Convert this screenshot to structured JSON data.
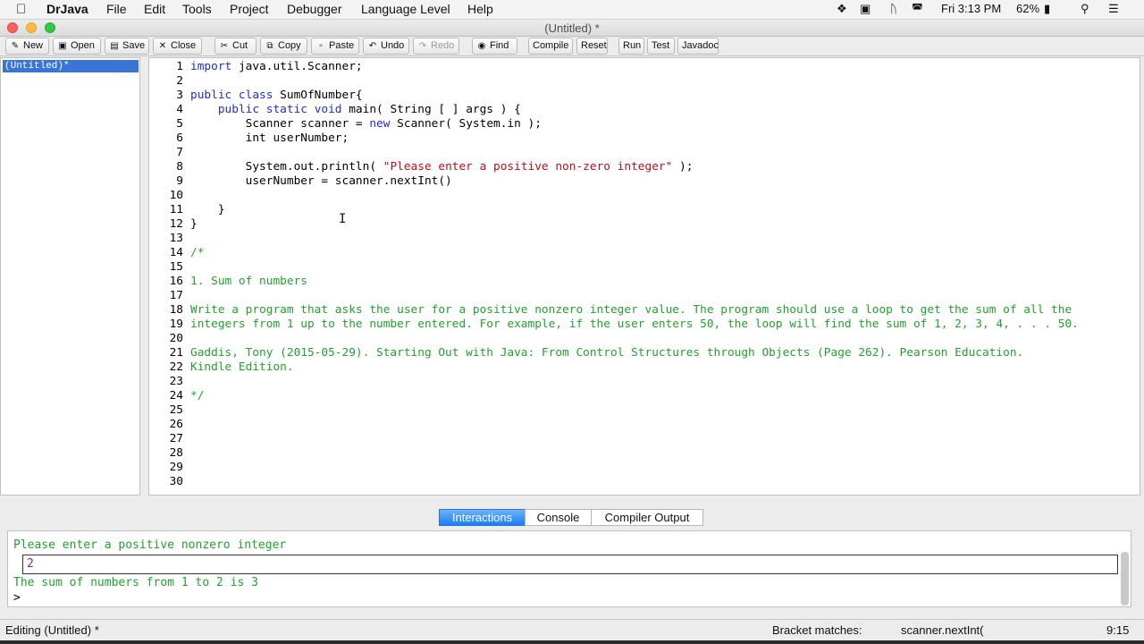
{
  "menubar": {
    "app_name": "DrJava",
    "menus": [
      "File",
      "Edit",
      "Tools",
      "Project",
      "Debugger",
      "Language Level",
      "Help"
    ],
    "clock": "Fri 3:13 PM",
    "battery": "62%"
  },
  "window": {
    "title": "(Untitled) *"
  },
  "toolbar": {
    "new": "New",
    "open": "Open",
    "save": "Save",
    "close": "Close",
    "cut": "Cut",
    "copy": "Copy",
    "paste": "Paste",
    "undo": "Undo",
    "redo": "Redo",
    "find": "Find",
    "compile": "Compile",
    "reset": "Reset",
    "run": "Run",
    "test": "Test",
    "javadoc": "Javadoc"
  },
  "files": {
    "selected": "(Untitled)*"
  },
  "editor": {
    "line_numbers": [
      "1",
      "2",
      "3",
      "4",
      "5",
      "6",
      "7",
      "8",
      "9",
      "10",
      "11",
      "12",
      "13",
      "14",
      "15",
      "16",
      "17",
      "18",
      "19",
      "20",
      "21",
      "22",
      "23",
      "24",
      "25",
      "26",
      "27",
      "28",
      "29",
      "30"
    ],
    "l1_kw": "import",
    "l1_rest": " java.util.Scanner;",
    "l3_kw": "public class",
    "l3_rest": " SumOfNumber{",
    "l4_indent": "    ",
    "l4_kw": "public static void",
    "l4_rest": " main( String [ ] args ) {",
    "l5_a": "        Scanner scanner = ",
    "l5_kw": "new",
    "l5_b": " Scanner( System.in );",
    "l6": "        int userNumber;",
    "l8_a": "        System.out.println( ",
    "l8_str": "\"Please enter a positive non-zero integer\"",
    "l8_b": " );",
    "l9": "        userNumber = scanner.nextInt()",
    "l11": "    }",
    "l12": "}",
    "l14": "/*",
    "l16": "1. Sum of numbers",
    "l18": "Write a program that asks the user for a positive nonzero integer value. The program should use a loop to get the sum of all the",
    "l19": "integers from 1 up to the number entered. For example, if the user enters 50, the loop will find the sum of 1, 2, 3, 4, . . . 50.",
    "l21": "Gaddis, Tony (2015-05-29). Starting Out with Java: From Control Structures through Objects (Page 262). Pearson Education.",
    "l22": "Kindle Edition.",
    "l24": "*/"
  },
  "bottom_tabs": {
    "interactions": "Interactions",
    "console": "Console",
    "compiler_output": "Compiler Output"
  },
  "interactions": {
    "prompt_line": "Please enter a positive nonzero integer",
    "input_value": "2",
    "result_line": "The sum of numbers from 1 to 2 is 3",
    "prompt": ">"
  },
  "statusbar": {
    "editing": "Editing (Untitled) *",
    "bracket_label": "Bracket matches:",
    "bracket_value": "scanner.nextInt(",
    "position": "9:15"
  },
  "colors": {
    "keyword": "#1e2fcb",
    "string": "#b40f1a",
    "comment": "#24a02e",
    "accent": "#1a7ef2"
  }
}
